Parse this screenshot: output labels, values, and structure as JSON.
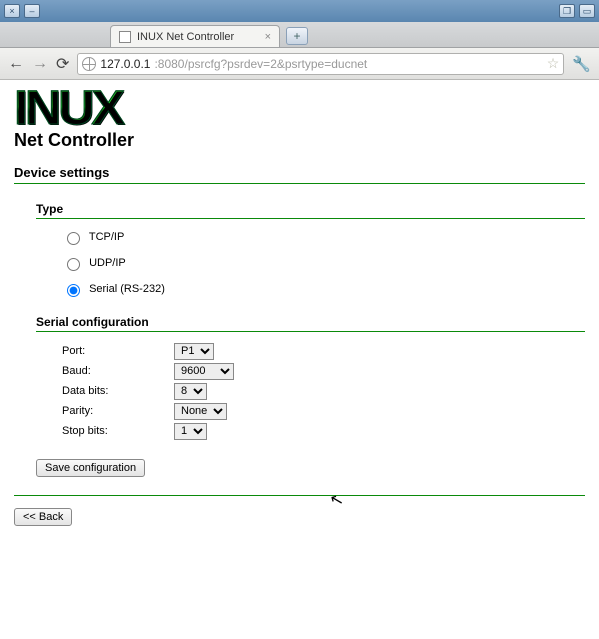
{
  "window": {
    "btn_close": "×",
    "btn_min": "–",
    "btn_max": "❐",
    "btn_restore": "▭"
  },
  "browser": {
    "tab_title": "INUX Net Controller",
    "tab_close": "×",
    "newtab": "+",
    "url_host": "127.0.0.1",
    "url_path": ":8080/psrcfg?psrdev=2&psrtype=ducnet",
    "star": "☆"
  },
  "logo": {
    "main": "INUX",
    "sub": "Net Controller"
  },
  "sections": {
    "device": "Device settings",
    "type": "Type",
    "serial": "Serial configuration"
  },
  "type_options": {
    "tcp": "TCP/IP",
    "udp": "UDP/IP",
    "serial": "Serial (RS-232)",
    "selected": "serial"
  },
  "serial_form": {
    "port_label": "Port:",
    "port_value": "P1",
    "baud_label": "Baud:",
    "baud_value": "9600",
    "databits_label": "Data bits:",
    "databits_value": "8",
    "parity_label": "Parity:",
    "parity_value": "None",
    "stopbits_label": "Stop bits:",
    "stopbits_value": "1"
  },
  "buttons": {
    "save": "Save configuration",
    "back": "<< Back"
  }
}
